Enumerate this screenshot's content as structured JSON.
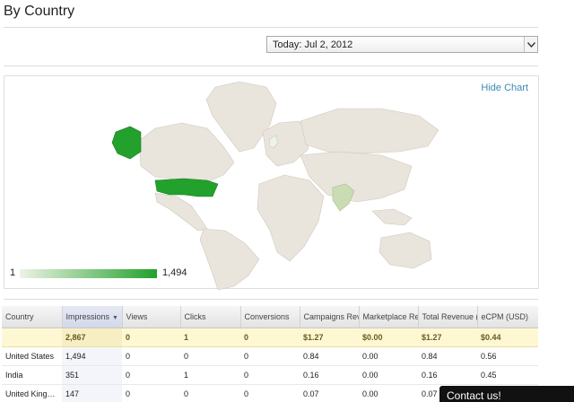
{
  "page": {
    "title": "By Country"
  },
  "date_picker": {
    "value": "Today: Jul 2, 2012",
    "icon": "chevron-down-icon"
  },
  "map": {
    "hide_chart_label": "Hide Chart",
    "legend_min": "1",
    "legend_max": "1,494",
    "colors": {
      "ocean": "#ffffff",
      "land_default": "#e9e4dc",
      "low": "#eef3e4",
      "mid": "#c9dcb3",
      "high": "#22a12d"
    },
    "highlighted_countries": [
      {
        "name": "United States",
        "impressions": 1494
      },
      {
        "name": "India",
        "impressions": 351
      },
      {
        "name": "United Kingdom",
        "impressions": 147
      }
    ]
  },
  "table": {
    "columns": [
      "Country",
      "Impressions",
      "Views",
      "Clicks",
      "Conversions",
      "Campaigns Reve",
      "Marketplace Rev",
      "Total Revenue (",
      "eCPM (USD)"
    ],
    "sorted_column": "Impressions",
    "total_row": [
      "",
      "2,867",
      "0",
      "1",
      "0",
      "$1.27",
      "$0.00",
      "$1.27",
      "$0.44"
    ],
    "rows": [
      [
        "United States",
        "1,494",
        "0",
        "0",
        "0",
        "0.84",
        "0.00",
        "0.84",
        "0.56"
      ],
      [
        "India",
        "351",
        "0",
        "1",
        "0",
        "0.16",
        "0.00",
        "0.16",
        "0.45"
      ],
      [
        "United Kingd...",
        "147",
        "0",
        "0",
        "0",
        "0.07",
        "0.00",
        "0.07",
        ""
      ]
    ]
  },
  "contact": {
    "label": "Contact us!"
  }
}
